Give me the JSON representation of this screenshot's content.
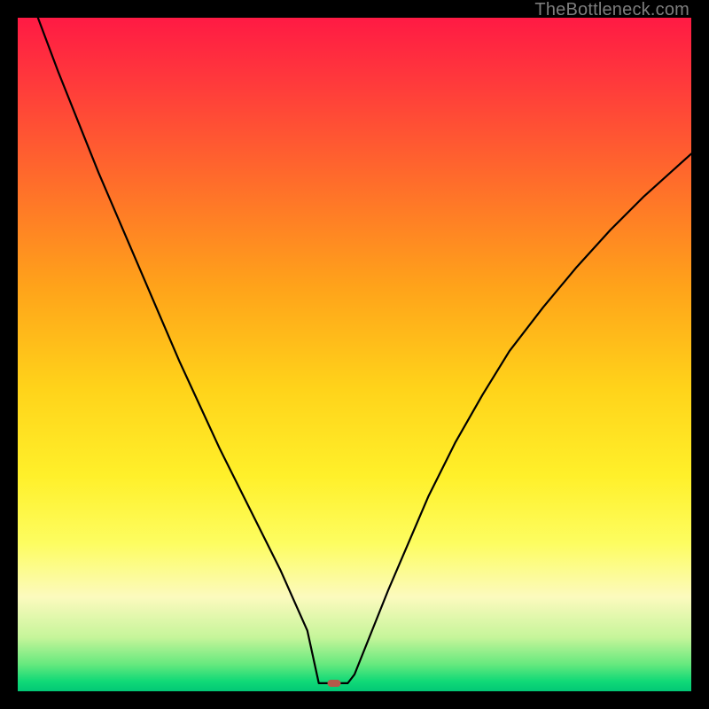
{
  "watermark": "TheBottleneck.com",
  "chart_data": {
    "type": "line",
    "title": "",
    "xlabel": "",
    "ylabel": "",
    "xlim": [
      0,
      100
    ],
    "ylim": [
      0,
      100
    ],
    "background_gradient": {
      "stops": [
        {
          "offset": 0.0,
          "color": "#ff1a44"
        },
        {
          "offset": 0.1,
          "color": "#ff3b3b"
        },
        {
          "offset": 0.25,
          "color": "#ff6f2a"
        },
        {
          "offset": 0.4,
          "color": "#ffa31a"
        },
        {
          "offset": 0.55,
          "color": "#ffd31a"
        },
        {
          "offset": 0.68,
          "color": "#fff02a"
        },
        {
          "offset": 0.78,
          "color": "#fdfd60"
        },
        {
          "offset": 0.86,
          "color": "#fcfabe"
        },
        {
          "offset": 0.92,
          "color": "#c6f59a"
        },
        {
          "offset": 0.96,
          "color": "#66e97e"
        },
        {
          "offset": 0.985,
          "color": "#11d977"
        },
        {
          "offset": 1.0,
          "color": "#02c876"
        }
      ]
    },
    "series": [
      {
        "name": "bottleneck-curve",
        "color": "#000000",
        "width": 2.2,
        "x": [
          3.0,
          6,
          9,
          12,
          15,
          18,
          21,
          24,
          27,
          30,
          33,
          36,
          39,
          41,
          43,
          44.7,
          46.5,
          48,
          49,
          50,
          52,
          55,
          58,
          61,
          65,
          69,
          73,
          78,
          83,
          88,
          93,
          98,
          100
        ],
        "y": [
          100,
          92,
          84.5,
          77,
          70,
          63,
          56,
          49,
          42.5,
          36,
          30,
          24,
          18,
          13.5,
          9,
          5,
          2.2,
          1.2,
          1.2,
          2.5,
          7.5,
          15,
          22,
          29,
          37,
          44,
          50.5,
          57,
          63,
          68.5,
          73.5,
          78,
          79.8
        ]
      }
    ],
    "flat_bottom": {
      "x0": 44.7,
      "x1": 49.0,
      "y": 1.2
    },
    "marker": {
      "x": 47.0,
      "y": 1.2,
      "color": "#b45a4a"
    }
  }
}
